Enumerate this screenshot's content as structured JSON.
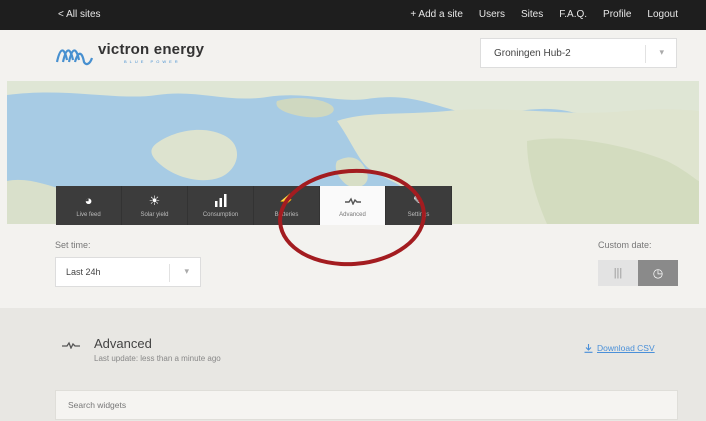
{
  "topbar": {
    "back_label": "< All sites",
    "nav": [
      "+ Add a site",
      "Users",
      "Sites",
      "F.A.Q.",
      "Profile",
      "Logout"
    ]
  },
  "brand": {
    "name": "victron energy",
    "tagline": "BLUE POWER",
    "color": "#4790d0"
  },
  "site_selector": {
    "value": "Groningen Hub-2",
    "icon": "chevron-down-icon"
  },
  "map": {
    "pin_icon": "waveform-icon",
    "pin_color": "#4a90d9"
  },
  "tabs": [
    {
      "label": "Live feed",
      "icon": "meter-icon"
    },
    {
      "label": "Solar yield",
      "icon": "sun-icon"
    },
    {
      "label": "Consumption",
      "icon": "bar-chart-icon"
    },
    {
      "label": "Batteries",
      "icon": "battery-icon"
    },
    {
      "label": "Advanced",
      "icon": "waveform-icon",
      "active": true
    },
    {
      "label": "Settings",
      "icon": "wrench-icon"
    }
  ],
  "time": {
    "set_time_label": "Set time:",
    "selected": "Last 24h",
    "custom_date_label": "Custom date:"
  },
  "toggle": {
    "options": [
      {
        "icon": "range-icon",
        "glyph": "|||"
      },
      {
        "icon": "clock-icon",
        "glyph": "◷",
        "active": true
      }
    ]
  },
  "advanced": {
    "title": "Advanced",
    "last_update": "Last update: less than a minute ago",
    "download_label": "Download CSV",
    "download_icon": "download-icon",
    "search_placeholder": "Search widgets"
  },
  "annotation_color": "#a31c20"
}
